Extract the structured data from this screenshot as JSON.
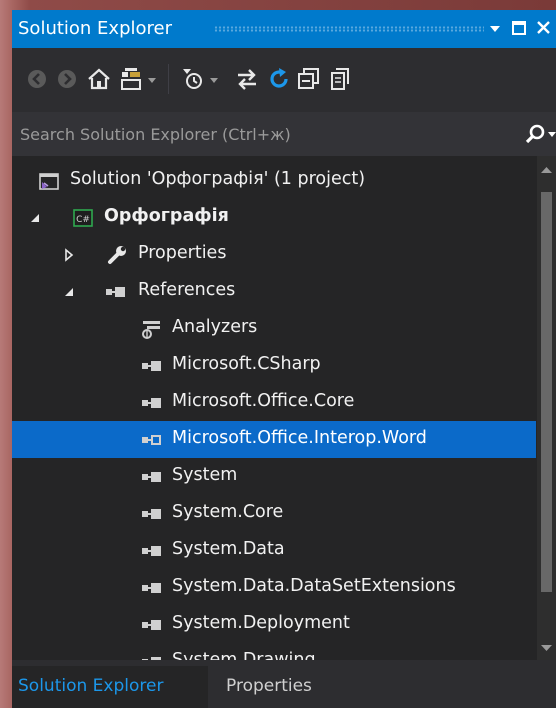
{
  "window": {
    "title": "Solution Explorer",
    "title_buttons": [
      "dropdown-arrow-icon",
      "maximize-icon",
      "close-icon"
    ]
  },
  "toolbar": {
    "buttons": [
      "back-icon",
      "forward-icon",
      "home-icon",
      "switch-views-icon",
      "pending-changes-filter-icon",
      "sync-with-active-document-icon",
      "refresh-icon",
      "collapse-all-icon",
      "show-all-files-icon"
    ]
  },
  "search": {
    "placeholder": "Search Solution Explorer (Ctrl+ж)",
    "value": ""
  },
  "tree": {
    "items": [
      {
        "label": "Solution 'Орфографія' (1 project)",
        "icon": "solution-icon",
        "expander": "none",
        "bold": false,
        "selected": false
      },
      {
        "label": "Орфографія",
        "icon": "csharp-project-icon",
        "expander": "expanded",
        "bold": true,
        "selected": false
      },
      {
        "label": "Properties",
        "icon": "wrench-icon",
        "expander": "collapsed",
        "bold": false,
        "selected": false
      },
      {
        "label": "References",
        "icon": "reference-icon",
        "expander": "expanded",
        "bold": false,
        "selected": false
      },
      {
        "label": "Analyzers",
        "icon": "analyzer-icon",
        "expander": "none",
        "bold": false,
        "selected": false
      },
      {
        "label": "Microsoft.CSharp",
        "icon": "reference-icon",
        "expander": "none",
        "bold": false,
        "selected": false
      },
      {
        "label": "Microsoft.Office.Core",
        "icon": "reference-icon",
        "expander": "none",
        "bold": false,
        "selected": false
      },
      {
        "label": "Microsoft.Office.Interop.Word",
        "icon": "reference-icon",
        "expander": "none",
        "bold": false,
        "selected": true
      },
      {
        "label": "System",
        "icon": "reference-icon",
        "expander": "none",
        "bold": false,
        "selected": false
      },
      {
        "label": "System.Core",
        "icon": "reference-icon",
        "expander": "none",
        "bold": false,
        "selected": false
      },
      {
        "label": "System.Data",
        "icon": "reference-icon",
        "expander": "none",
        "bold": false,
        "selected": false
      },
      {
        "label": "System.Data.DataSetExtensions",
        "icon": "reference-icon",
        "expander": "none",
        "bold": false,
        "selected": false
      },
      {
        "label": "System.Deployment",
        "icon": "reference-icon",
        "expander": "none",
        "bold": false,
        "selected": false
      },
      {
        "label": "System.Drawing",
        "icon": "reference-icon",
        "expander": "none",
        "bold": false,
        "selected": false
      }
    ]
  },
  "tabs": {
    "active": "Solution Explorer",
    "inactive": "Properties"
  },
  "colors": {
    "accent": "#007acc",
    "selection": "#0b6ac9",
    "background": "#252526",
    "text": "#f1f1f1",
    "active_tab_text": "#1c97ea"
  }
}
